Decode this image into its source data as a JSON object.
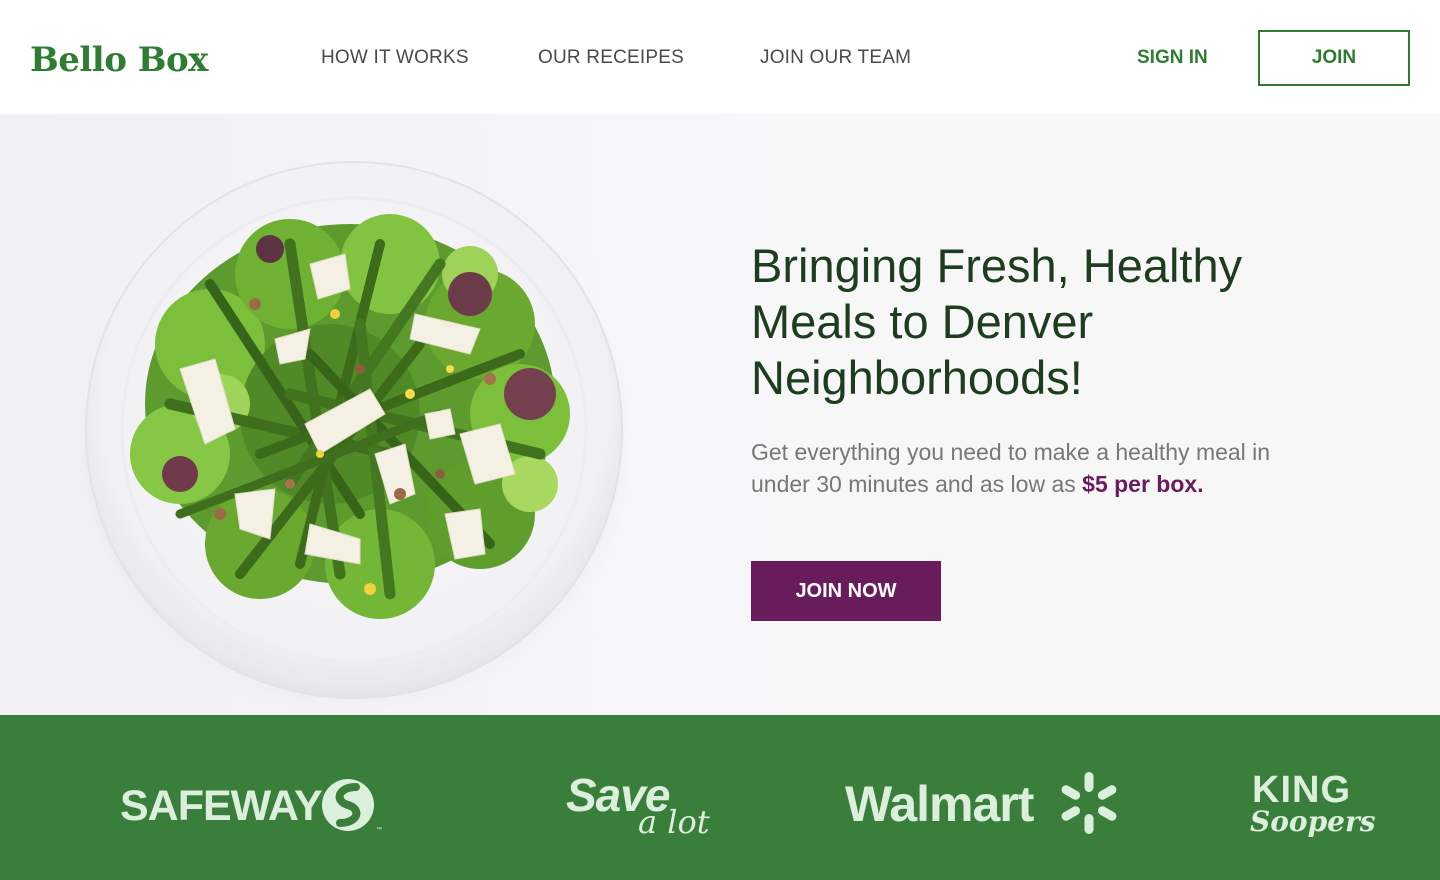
{
  "brand": {
    "logo_text": "Bello Box",
    "primary_color": "#2e7d32",
    "accent_color": "#691c5c"
  },
  "nav": {
    "items": [
      {
        "label": "HOW IT WORKS"
      },
      {
        "label": "OUR RECEIPES"
      },
      {
        "label": "JOIN OUR TEAM"
      }
    ],
    "sign_in_label": "SIGN IN",
    "join_label": "JOIN"
  },
  "hero": {
    "title_lines": [
      "Bringing Fresh, Healthy",
      "Meals to Denver",
      "Neighborhoods!"
    ],
    "subtitle_prefix": "Get everything you need to make a healthy meal in under 30 minutes and as low as ",
    "subtitle_price": "$5 per box.",
    "cta_label": "JOIN NOW",
    "image_icon": "salad-plate-image"
  },
  "partners": {
    "background_color": "#3a7e3c",
    "items": [
      {
        "name": "SAFEWAY",
        "icon": "safeway-logo"
      },
      {
        "name_main": "Save",
        "name_sub": "a lot",
        "icon": "save-a-lot-logo"
      },
      {
        "name": "Walmart",
        "icon": "walmart-spark-logo"
      },
      {
        "name_main": "KING",
        "name_sub": "Soopers",
        "icon": "king-soopers-logo"
      }
    ]
  }
}
